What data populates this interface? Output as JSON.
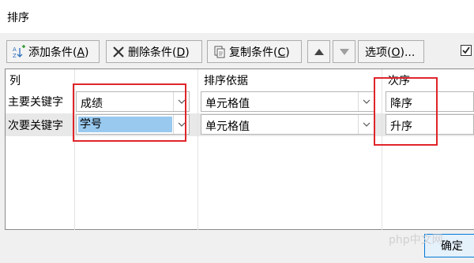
{
  "dialog": {
    "title": "排序"
  },
  "toolbar": {
    "add_label": "添加条件(",
    "add_mnemonic": "A",
    "add_close": ")",
    "delete_label": "删除条件(",
    "delete_mnemonic": "D",
    "delete_close": ")",
    "copy_label": "复制条件(",
    "copy_mnemonic": "C",
    "copy_close": ")",
    "options_label": "选项(",
    "options_mnemonic": "O",
    "options_close": ")..."
  },
  "columns": {
    "col": "列",
    "sort_on": "排序依据",
    "order": "次序"
  },
  "rows": [
    {
      "label": "主要关键字",
      "column": "成绩",
      "sort_on": "单元格值",
      "order": "降序"
    },
    {
      "label": "次要关键字",
      "column": "学号",
      "sort_on": "单元格值",
      "order": "升序"
    }
  ],
  "footer": {
    "ok_label": "确定"
  },
  "watermark": "php中文网",
  "colors": {
    "highlight": "#e0242a",
    "selection": "#99c9ef"
  }
}
